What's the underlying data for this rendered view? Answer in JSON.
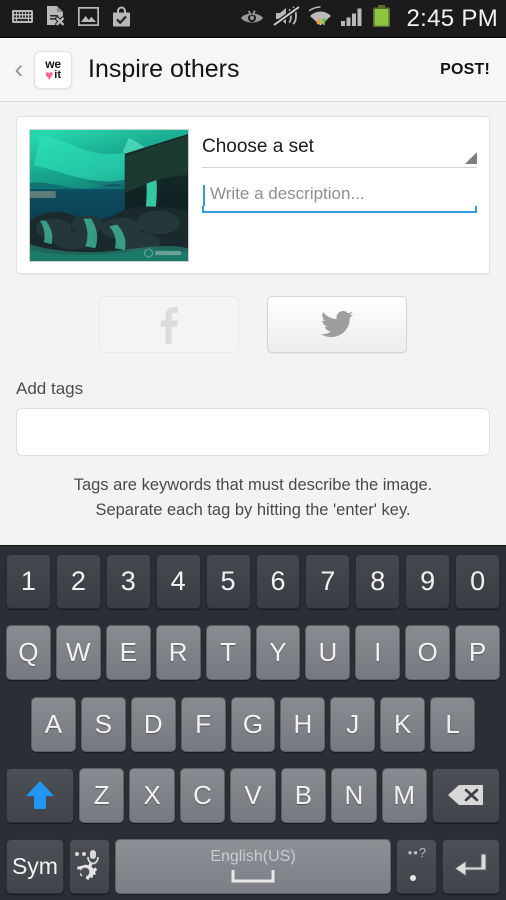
{
  "status_bar": {
    "time": "2:45 PM",
    "left_icons": [
      "keyboard-icon",
      "document-remove-icon",
      "image-icon",
      "bag-check-icon"
    ],
    "right_icons": [
      "eye-icon",
      "mute-icon",
      "wifi-data-icon",
      "signal-bars-icon",
      "battery-icon"
    ],
    "battery_color": "#8cc63e",
    "background": "#1b1b1b"
  },
  "app_bar": {
    "back_glyph": "‹",
    "logo": {
      "top_text": "we",
      "heart": "♥",
      "bottom_text": "it",
      "heart_color": "#ff5f8f"
    },
    "title": "Inspire others",
    "post_label": "POST!"
  },
  "card": {
    "thumbnail_name": "aurora-waterfall-photo",
    "set_selector": {
      "label": "Choose a set",
      "has_dropdown": true
    },
    "description": {
      "value": "",
      "placeholder": "Write a description..."
    }
  },
  "social": {
    "facebook_label": "facebook-share-toggle",
    "twitter_label": "twitter-share-toggle",
    "facebook_glyph": "f"
  },
  "tags": {
    "section_label": "Add tags",
    "input_value": "",
    "input_placeholder": "",
    "helper_line_1": "Tags are keywords that must describe the image.",
    "helper_line_2": "Separate each tag by hitting the 'enter' key."
  },
  "keyboard": {
    "language": "English(US)",
    "sym_label": "Sym",
    "rows": {
      "numbers": [
        "1",
        "2",
        "3",
        "4",
        "5",
        "6",
        "7",
        "8",
        "9",
        "0"
      ],
      "top": [
        "Q",
        "W",
        "E",
        "R",
        "T",
        "Y",
        "U",
        "I",
        "O",
        "P"
      ],
      "home": [
        "A",
        "S",
        "D",
        "F",
        "G",
        "H",
        "J",
        "K",
        "L"
      ],
      "bottom": [
        "Z",
        "X",
        "C",
        "V",
        "B",
        "N",
        "M"
      ]
    },
    "period_marks": "••?",
    "shift_color": "#2196f3"
  },
  "colors": {
    "page_bg": "#f3f3f3",
    "app_bar_bg": "#f6f6f6",
    "keyboard_bg": "#2b2e36",
    "accent_blue": "#2f9bdd"
  }
}
